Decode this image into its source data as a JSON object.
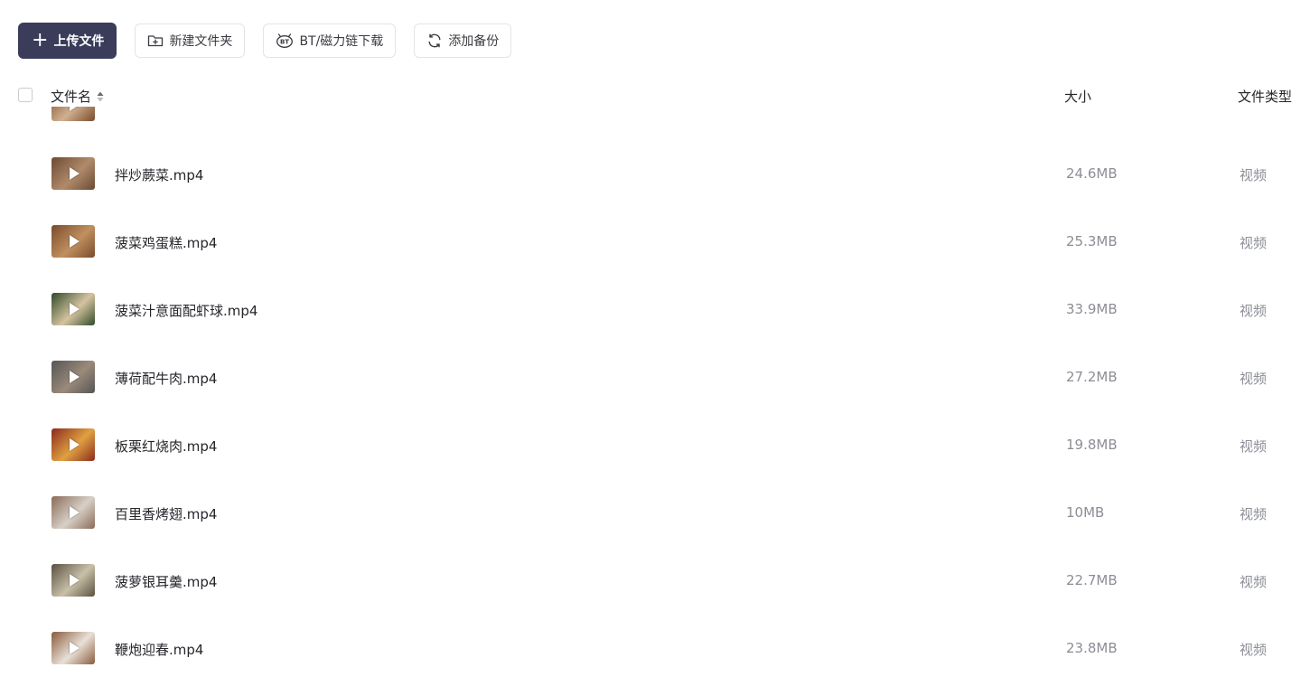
{
  "toolbar": {
    "upload_label": "上传文件",
    "new_folder_label": "新建文件夹",
    "bt_label": "BT/磁力链下载",
    "backup_label": "添加备份"
  },
  "table": {
    "headers": {
      "name": "文件名",
      "size": "大小",
      "type": "文件类型"
    },
    "rows": [
      {
        "name": "拌炒蕨菜.mp4",
        "size": "24.6MB",
        "type": "视频",
        "thumb_colors": [
          "#6b4a34",
          "#b08a6a"
        ]
      },
      {
        "name": "菠菜鸡蛋糕.mp4",
        "size": "25.3MB",
        "type": "视频",
        "thumb_colors": [
          "#7a4b2a",
          "#c09060"
        ]
      },
      {
        "name": "菠菜汁意面配虾球.mp4",
        "size": "33.9MB",
        "type": "视频",
        "thumb_colors": [
          "#2f4a2a",
          "#d6c3a0"
        ]
      },
      {
        "name": "薄荷配牛肉.mp4",
        "size": "27.2MB",
        "type": "视频",
        "thumb_colors": [
          "#555555",
          "#9a8a7a"
        ]
      },
      {
        "name": "板栗红烧肉.mp4",
        "size": "19.8MB",
        "type": "视频",
        "thumb_colors": [
          "#8a2a1e",
          "#e0a040"
        ]
      },
      {
        "name": "百里香烤翅.mp4",
        "size": "10MB",
        "type": "视频",
        "thumb_colors": [
          "#8a6a55",
          "#d8d0c8"
        ]
      },
      {
        "name": "菠萝银耳羹.mp4",
        "size": "22.7MB",
        "type": "视频",
        "thumb_colors": [
          "#5a5040",
          "#c8c0a8"
        ]
      },
      {
        "name": "鞭炮迎春.mp4",
        "size": "23.8MB",
        "type": "视频",
        "thumb_colors": [
          "#8a5a3a",
          "#e8e0d8"
        ]
      }
    ],
    "partial_top_row": {
      "thumb_colors": [
        "#7a4b2a",
        "#d0b090"
      ]
    }
  },
  "icons": {
    "upload": "plus-icon",
    "new_folder": "folder-plus-icon",
    "bt": "bt-icon",
    "backup": "sync-icon",
    "sort": "sort-icon",
    "play": "play-icon"
  }
}
